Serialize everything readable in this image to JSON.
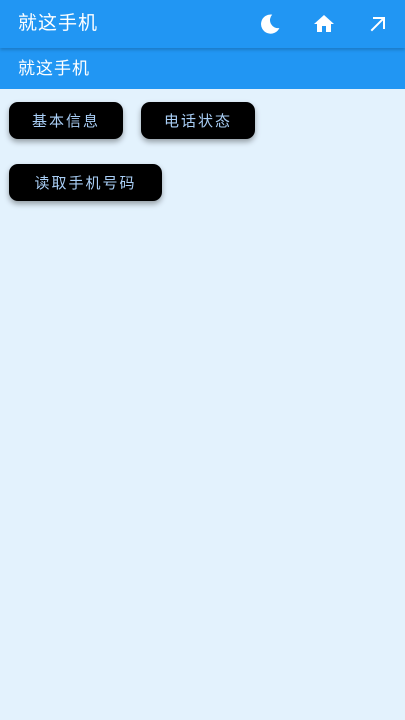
{
  "appbar": {
    "title": "就这手机",
    "actions": [
      {
        "icon": "moon-icon"
      },
      {
        "icon": "home-icon"
      },
      {
        "icon": "arrow-up-right-icon"
      }
    ]
  },
  "subbar": {
    "title": "就这手机"
  },
  "buttons": [
    {
      "label": "基本信息"
    },
    {
      "label": "电话状态"
    },
    {
      "label": "读取手机号码"
    }
  ],
  "colors": {
    "primary": "#2196F3",
    "background": "#E3F2FD",
    "button_bg": "#000000",
    "button_text": "#A9CEF5",
    "icon": "#FFFFFF"
  }
}
